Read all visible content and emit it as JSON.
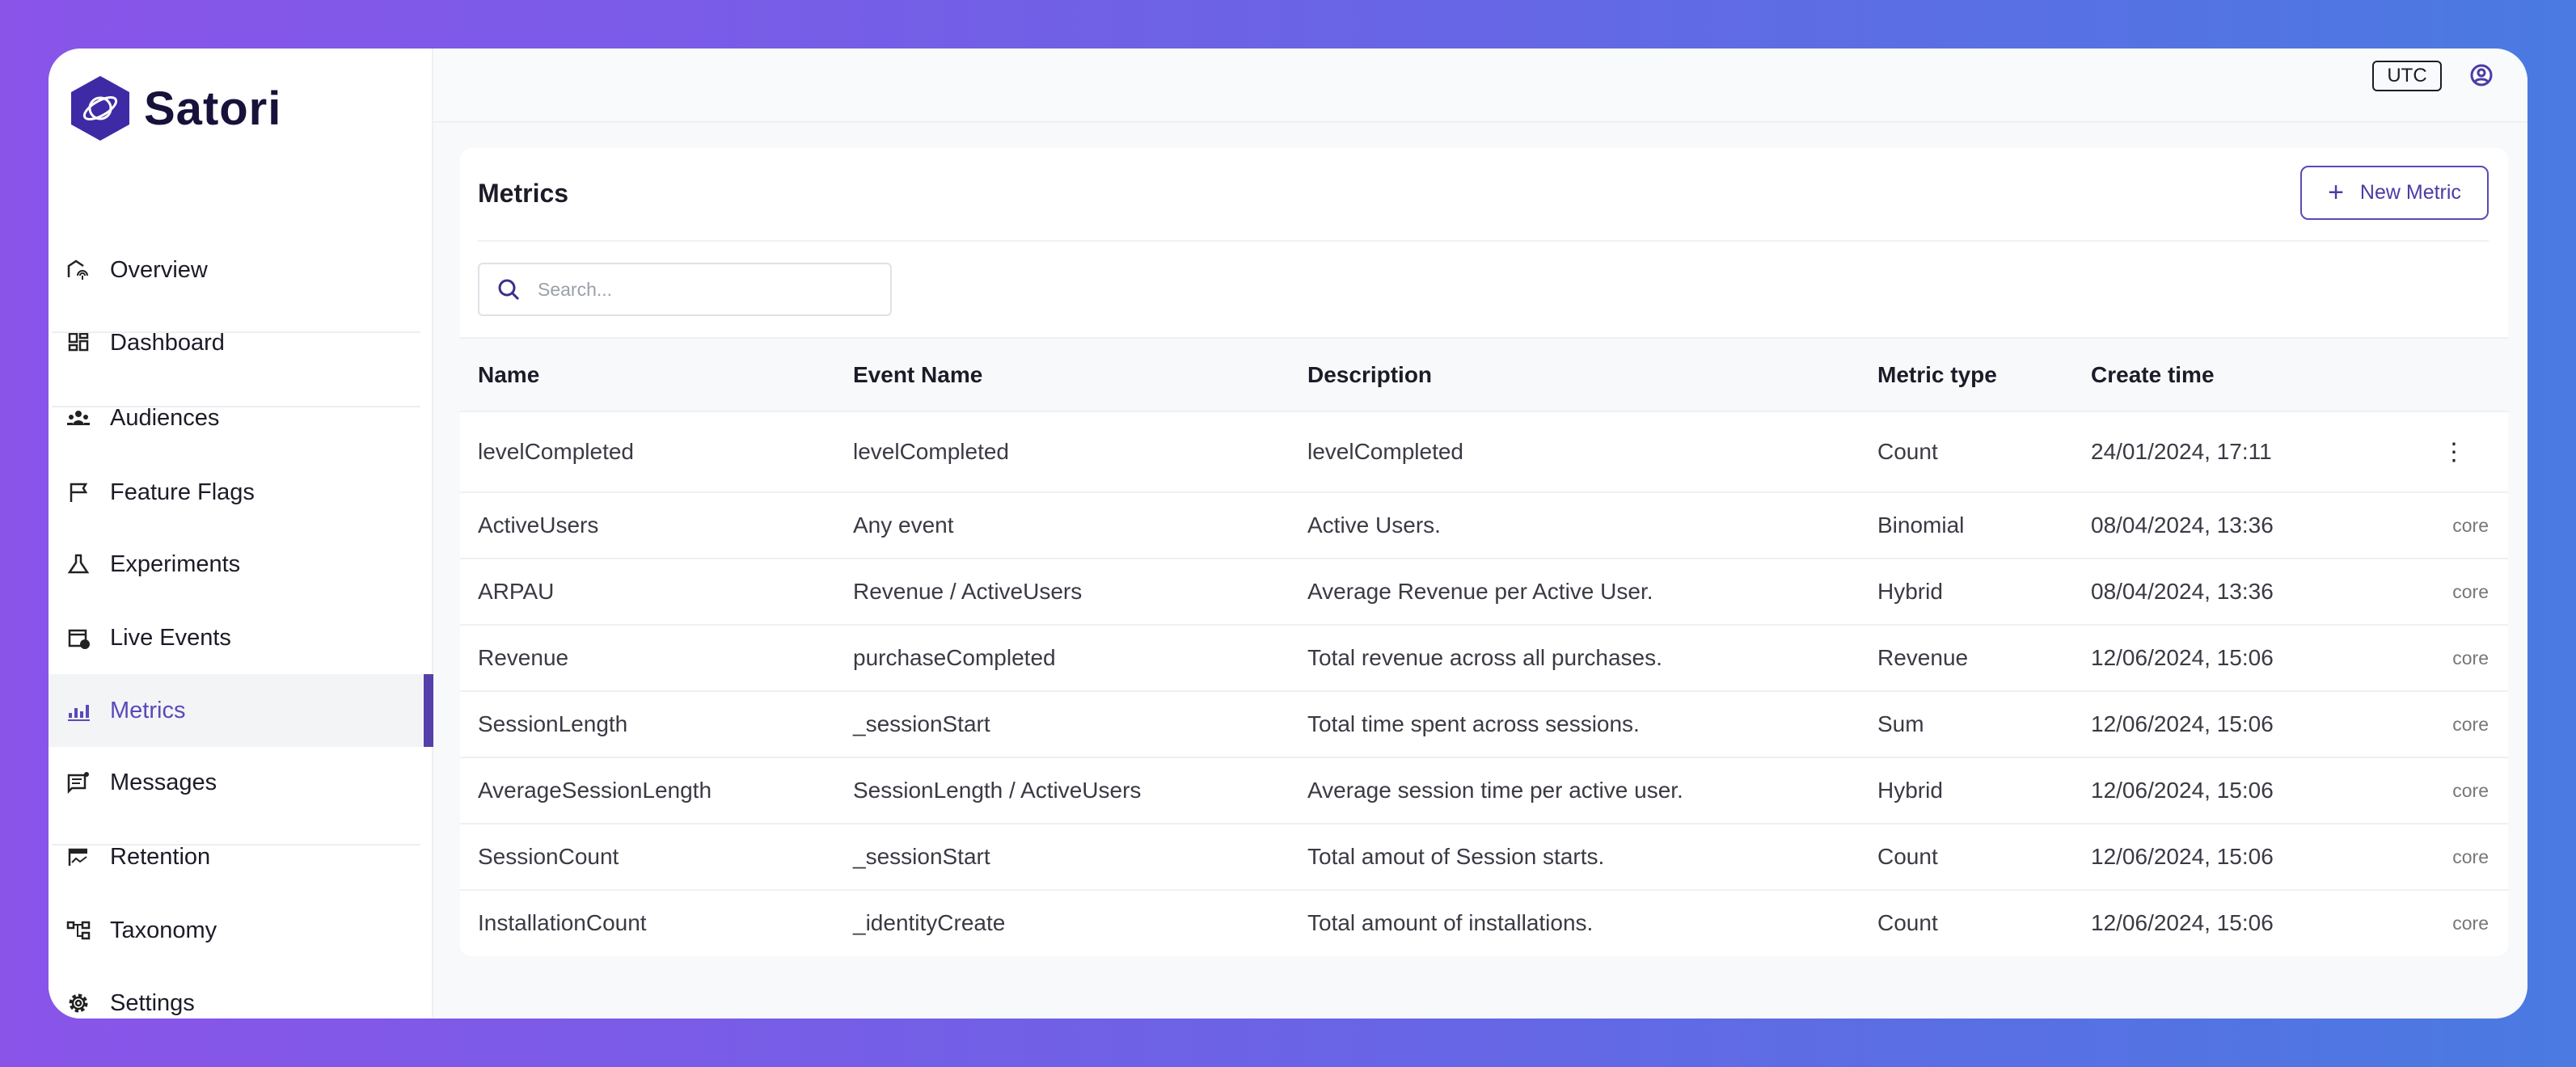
{
  "brand": {
    "name": "Satori"
  },
  "sidebar": {
    "items": [
      {
        "label": "Overview",
        "icon": "overview-icon"
      },
      {
        "label": "Dashboard",
        "icon": "dashboard-icon"
      },
      {
        "label": "Audiences",
        "icon": "audiences-icon"
      },
      {
        "label": "Feature Flags",
        "icon": "flag-icon"
      },
      {
        "label": "Experiments",
        "icon": "flask-icon"
      },
      {
        "label": "Live Events",
        "icon": "calendar-clock-icon"
      },
      {
        "label": "Metrics",
        "icon": "bar-chart-icon",
        "active": true
      },
      {
        "label": "Messages",
        "icon": "message-icon"
      },
      {
        "label": "Retention",
        "icon": "retention-icon"
      },
      {
        "label": "Taxonomy",
        "icon": "taxonomy-icon"
      },
      {
        "label": "Settings",
        "icon": "gear-icon"
      }
    ]
  },
  "topbar": {
    "timezone": "UTC"
  },
  "main": {
    "title": "Metrics",
    "new_button": "New Metric",
    "search_placeholder": "Search...",
    "columns": [
      "Name",
      "Event Name",
      "Description",
      "Metric type",
      "Create time"
    ],
    "rows": [
      [
        "levelCompleted",
        "levelCompleted",
        "levelCompleted",
        "Count",
        "24/01/2024, 17:11",
        ""
      ],
      [
        "ActiveUsers",
        "Any event",
        "Active Users.",
        "Binomial",
        "08/04/2024, 13:36",
        "core"
      ],
      [
        "ARPAU",
        "Revenue / ActiveUsers",
        "Average Revenue per Active User.",
        "Hybrid",
        "08/04/2024, 13:36",
        "core"
      ],
      [
        "Revenue",
        "purchaseCompleted",
        "Total revenue across all purchases.",
        "Revenue",
        "12/06/2024, 15:06",
        "core"
      ],
      [
        "SessionLength",
        "_sessionStart",
        "Total time spent across sessions.",
        "Sum",
        "12/06/2024, 15:06",
        "core"
      ],
      [
        "AverageSessionLength",
        "SessionLength / ActiveUsers",
        "Average session time per active user.",
        "Hybrid",
        "12/06/2024, 15:06",
        "core"
      ],
      [
        "SessionCount",
        "_sessionStart",
        "Total amout of Session starts.",
        "Count",
        "12/06/2024, 15:06",
        "core"
      ],
      [
        "InstallationCount",
        "_identityCreate",
        "Total amount of installations.",
        "Count",
        "12/06/2024, 15:06",
        "core"
      ]
    ]
  },
  "colors": {
    "accent": "#5440a8",
    "brand": "#3b2a9e"
  }
}
